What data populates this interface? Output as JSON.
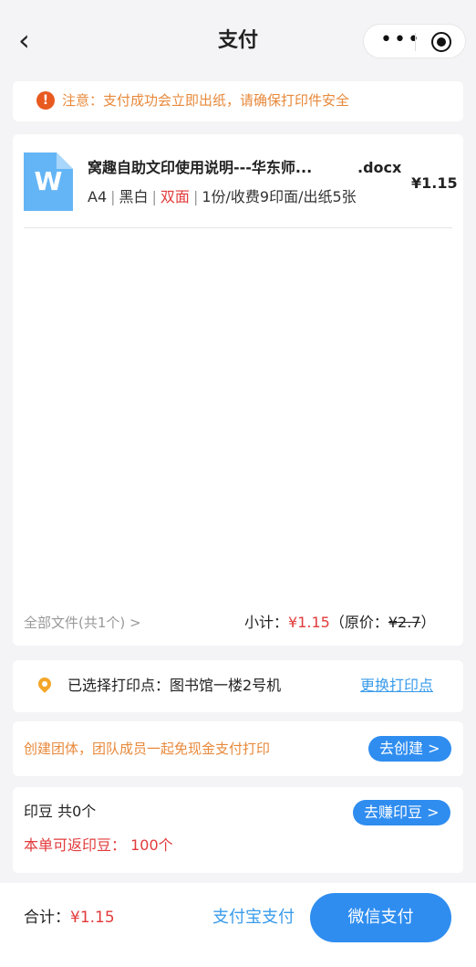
{
  "header": {
    "title": "支付"
  },
  "notice": {
    "text": "注意：支付成功会立即出纸，请确保打印件安全"
  },
  "file": {
    "name": "窝趣自助文印使用说明---华东师...",
    "ext": ".docx",
    "price": "¥1.15",
    "meta_size": "A4",
    "meta_color": "黑白",
    "meta_duplex": "双面",
    "meta_rest": "1份/收费9印面/出纸5张"
  },
  "summary": {
    "all_files": "全部文件(共1个) >",
    "subtotal_label": "小计：",
    "subtotal_value": "¥1.15",
    "orig_prefix": "（原价：",
    "orig_value": "¥2.7",
    "orig_suffix": "）"
  },
  "location": {
    "text": "已选择打印点：图书馆一楼2号机",
    "change_link": "更换打印点"
  },
  "group": {
    "text": "创建团体，团队成员一起免现金支付打印",
    "button": "去创建 >"
  },
  "beans": {
    "count_text": "印豆 共0个",
    "refund_text": "本单可返印豆： 100个",
    "button": "去赚印豆 >"
  },
  "bottom": {
    "total_label": "合计：",
    "total_value": "¥1.15",
    "alipay": "支付宝支付",
    "wechat": "微信支付"
  },
  "colors": {
    "accent": "#2f8df0",
    "price_red": "#e23b3b",
    "notice_orange": "#e8893b"
  }
}
